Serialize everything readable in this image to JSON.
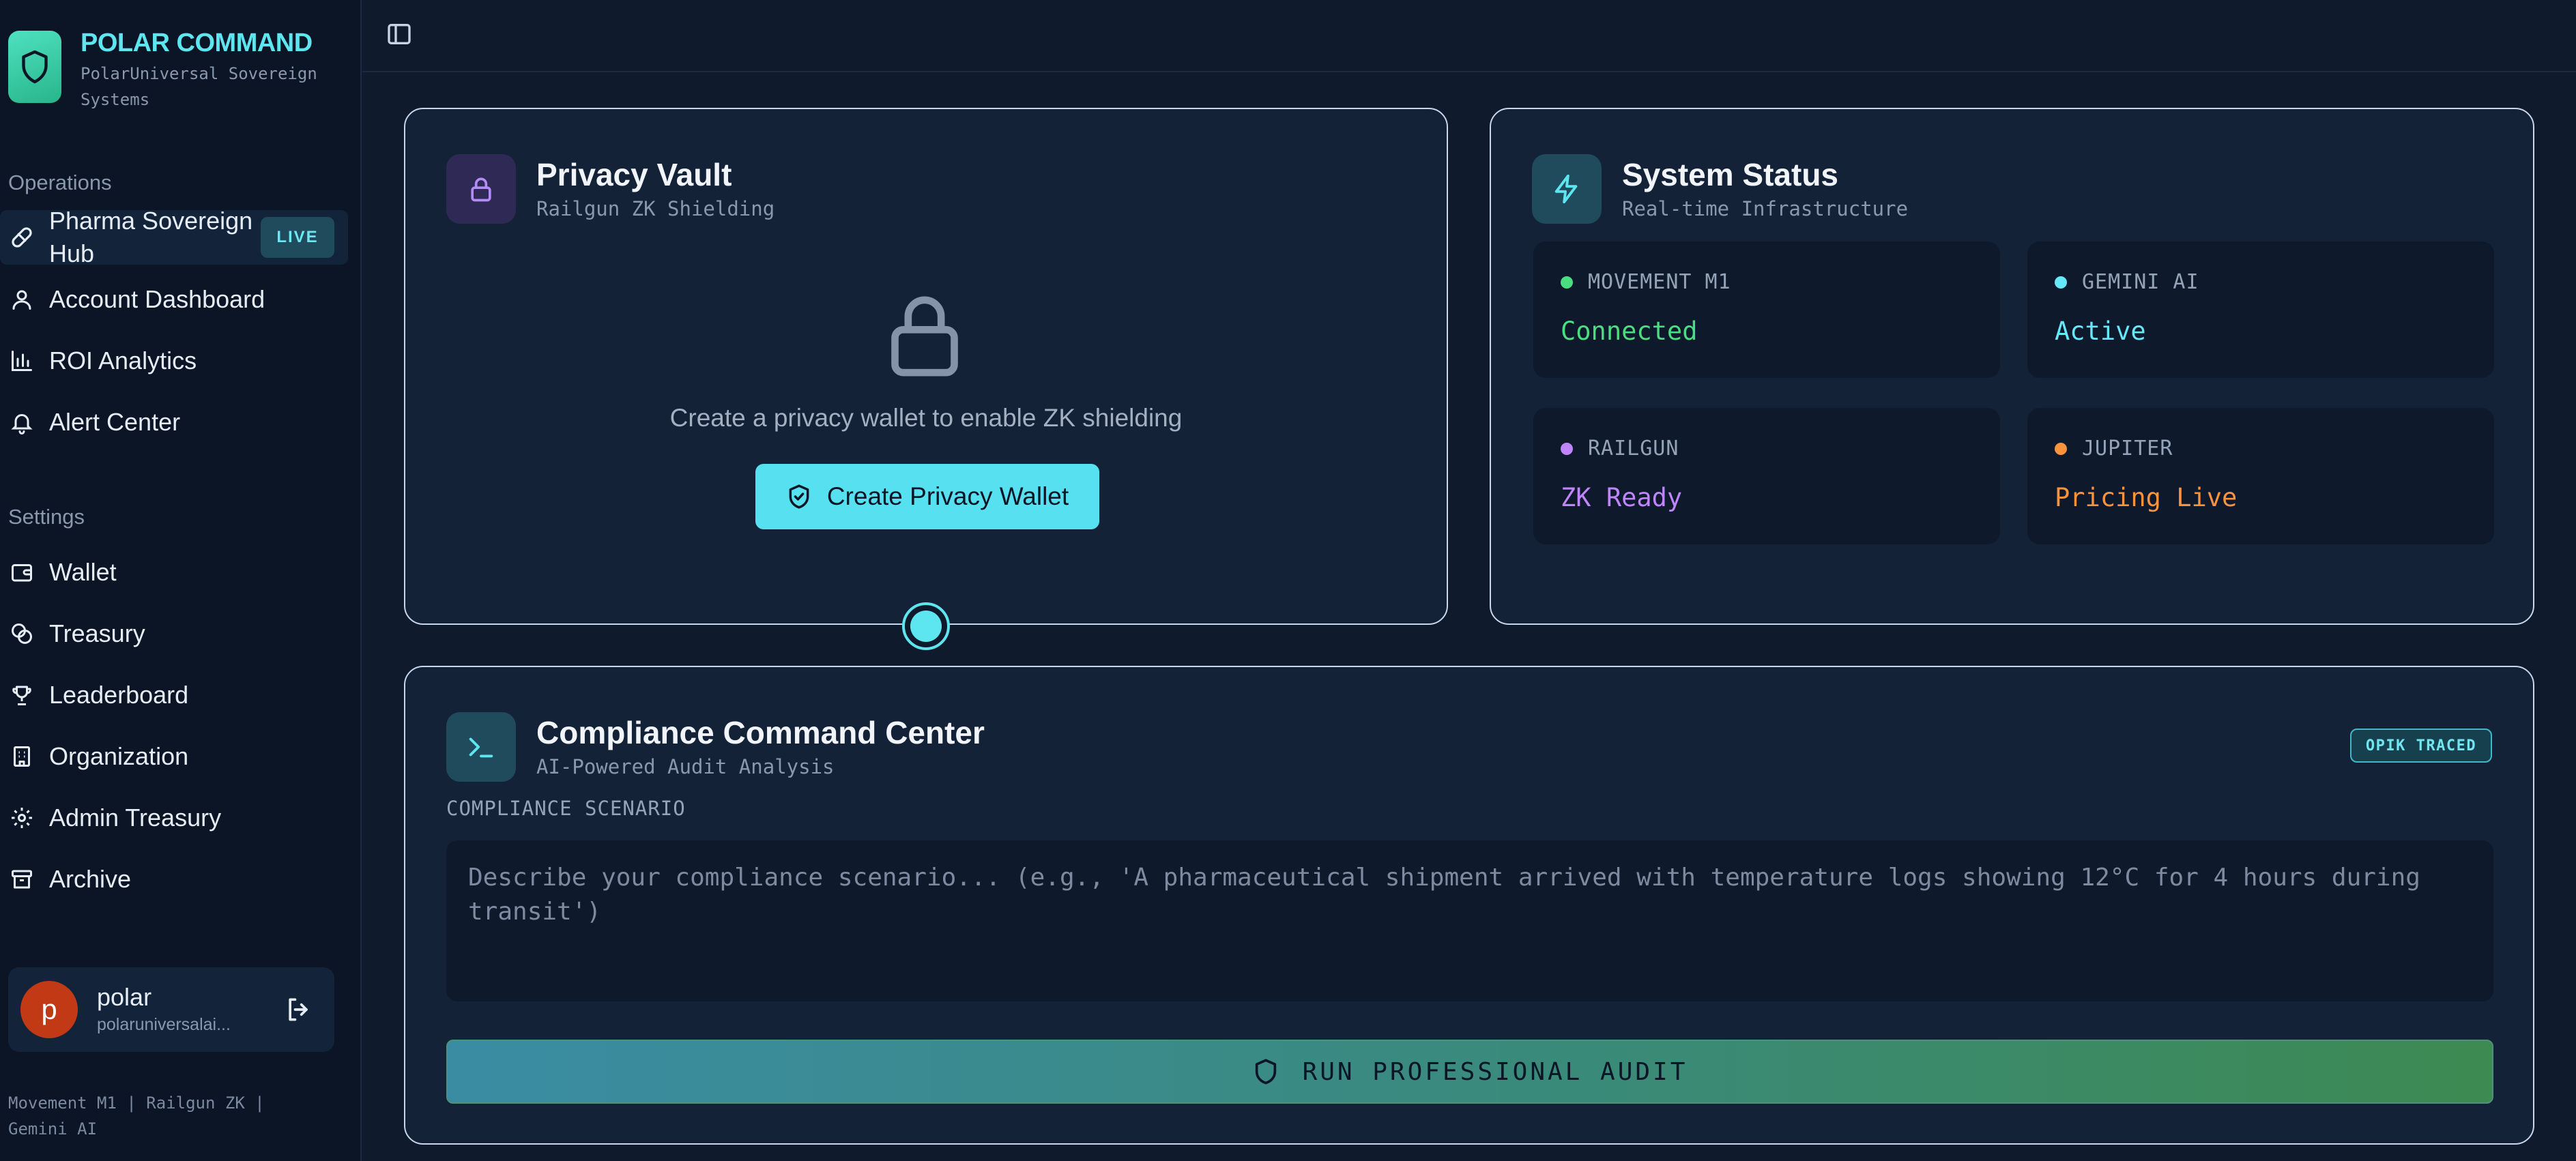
{
  "brand": {
    "title": "POLAR COMMAND",
    "subtitle": "PolarUniversal Sovereign Systems"
  },
  "sidebar": {
    "operations_label": "Operations",
    "operations": [
      {
        "label": "Pharma Sovereign Hub",
        "icon": "pill-icon",
        "badge": "LIVE",
        "active": true
      },
      {
        "label": "Account Dashboard",
        "icon": "user-icon"
      },
      {
        "label": "ROI Analytics",
        "icon": "bar-chart-icon"
      },
      {
        "label": "Alert Center",
        "icon": "bell-icon"
      }
    ],
    "settings_label": "Settings",
    "settings": [
      {
        "label": "Wallet",
        "icon": "wallet-icon"
      },
      {
        "label": "Treasury",
        "icon": "coins-icon"
      },
      {
        "label": "Leaderboard",
        "icon": "trophy-icon"
      },
      {
        "label": "Organization",
        "icon": "building-icon"
      },
      {
        "label": "Admin Treasury",
        "icon": "gear-icon"
      },
      {
        "label": "Archive",
        "icon": "archive-icon"
      }
    ],
    "user": {
      "initial": "p",
      "name": "polar",
      "email": "polaruniversalai..."
    },
    "footer": "Movement M1 | Railgun ZK | Gemini AI"
  },
  "privacy_vault": {
    "title": "Privacy Vault",
    "subtitle": "Railgun ZK Shielding",
    "empty_message": "Create a privacy wallet to enable ZK shielding",
    "create_button": "Create Privacy Wallet"
  },
  "system_status": {
    "title": "System Status",
    "subtitle": "Real-time Infrastructure",
    "services": [
      {
        "name": "MOVEMENT M1",
        "status": "Connected",
        "color": "#4ade80"
      },
      {
        "name": "GEMINI AI",
        "status": "Active",
        "color": "#67e8f9"
      },
      {
        "name": "RAILGUN",
        "status": "ZK Ready",
        "color": "#c084fc"
      },
      {
        "name": "JUPITER",
        "status": "Pricing Live",
        "color": "#fb923c"
      }
    ]
  },
  "compliance": {
    "title": "Compliance Command Center",
    "subtitle": "AI-Powered Audit Analysis",
    "badge": "OPIK TRACED",
    "field_label": "COMPLIANCE SCENARIO",
    "placeholder": "Describe your compliance scenario... (e.g., 'A pharmaceutical shipment arrived with temperature logs showing 12°C for 4 hours during transit')",
    "run_button": "RUN PROFESSIONAL AUDIT"
  },
  "colors": {
    "accent": "#5ee6f0",
    "card_bg": "#142238",
    "sidebar_bg": "#0b1525"
  }
}
